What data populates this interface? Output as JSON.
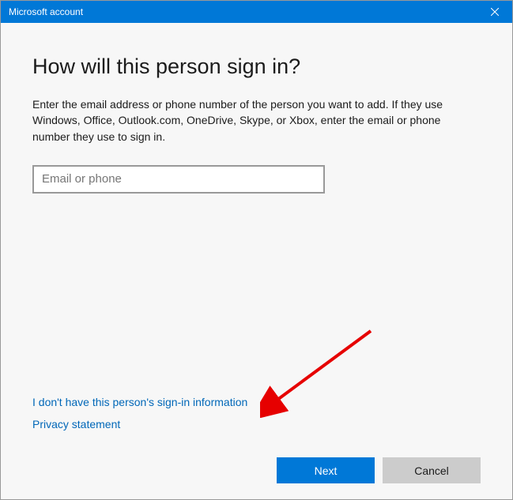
{
  "titlebar": {
    "title": "Microsoft account"
  },
  "main": {
    "heading": "How will this person sign in?",
    "description": "Enter the email address or phone number of the person you want to add. If they use Windows, Office, Outlook.com, OneDrive, Skype, or Xbox, enter the email or phone number they use to sign in.",
    "email_placeholder": "Email or phone",
    "email_value": ""
  },
  "links": {
    "no_info": "I don't have this person's sign-in information",
    "privacy": "Privacy statement"
  },
  "buttons": {
    "next": "Next",
    "cancel": "Cancel"
  }
}
